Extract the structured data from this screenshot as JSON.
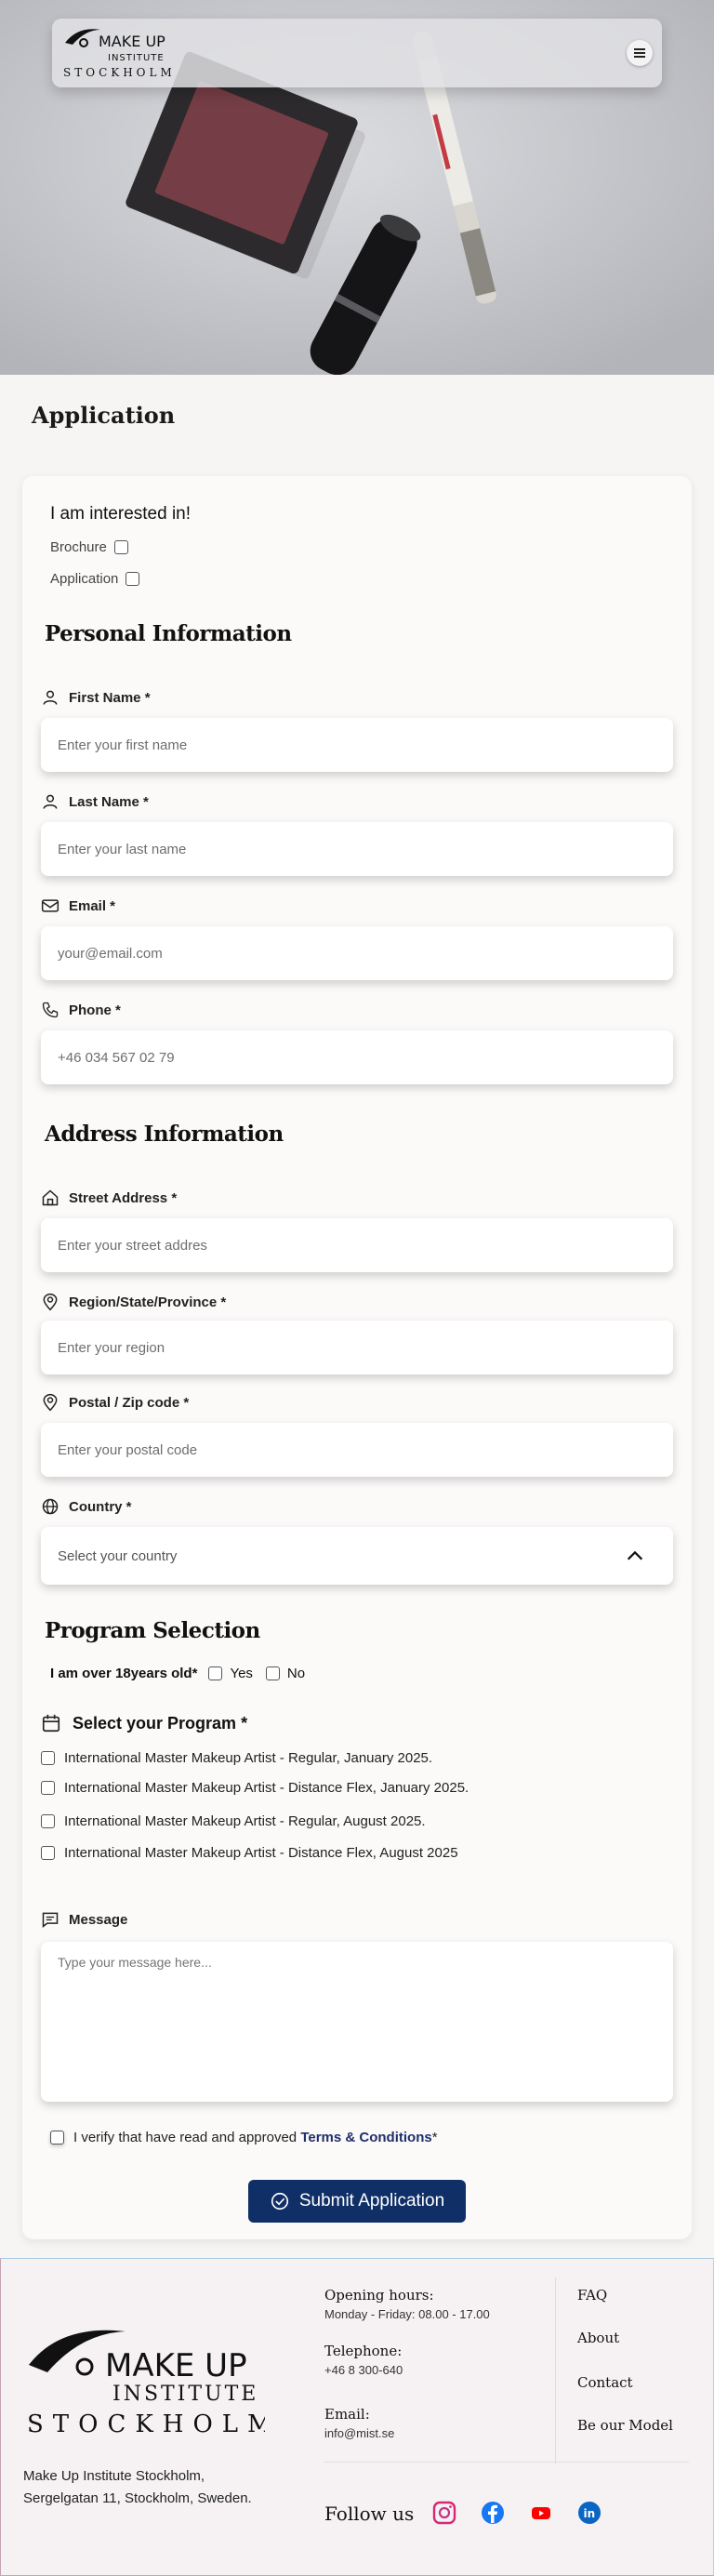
{
  "navbar": {
    "logo_line1": "MAKE UP",
    "logo_line2": "INSTITUTE",
    "logo_line3": "STOCKHOLM",
    "menu_icon": "hamburger-icon"
  },
  "page": {
    "title": "Application"
  },
  "interest": {
    "title": "I am interested in!",
    "options": [
      "Brochure",
      "Application"
    ]
  },
  "personal": {
    "heading": "Personal Information",
    "first_name": {
      "label": "First Name *",
      "placeholder": "Enter your first name"
    },
    "last_name": {
      "label": "Last Name *",
      "placeholder": "Enter your last name"
    },
    "email": {
      "label": "Email *",
      "placeholder": "your@email.com"
    },
    "phone": {
      "label": "Phone *",
      "placeholder": "+46 034 567 02 79"
    }
  },
  "address": {
    "heading": "Address Information",
    "street": {
      "label": "Street Address *",
      "placeholder": "Enter your street addres"
    },
    "region": {
      "label": "Region/State/Province *",
      "placeholder": "Enter your region"
    },
    "postal": {
      "label": "Postal / Zip code *",
      "placeholder": "Enter your postal code"
    },
    "country": {
      "label": "Country *",
      "placeholder": "Select your country"
    }
  },
  "program": {
    "heading": "Program Selection",
    "age_question": "I am over 18years old*",
    "yes": "Yes",
    "no": "No",
    "select_label": "Select your Program *",
    "options": [
      "International Master Makeup Artist - Regular, January 2025.",
      "International Master Makeup Artist - Distance Flex, January 2025.",
      "International Master Makeup Artist - Regular, August 2025.",
      "International Master Makeup Artist - Distance Flex, August 2025"
    ]
  },
  "message": {
    "label": "Message",
    "placeholder": "Type your message here..."
  },
  "verify": {
    "text": "I verify that have read and approved",
    "link": "Terms & Conditions",
    "suffix": "*"
  },
  "submit": {
    "label": "Submit Application"
  },
  "footer": {
    "logo_line1": "MAKE UP",
    "logo_line2": "INSTITUTE",
    "logo_line3": "STOCKHOLM",
    "address_line1": "Make Up Institute Stockholm,",
    "address_line2": "Sergelgatan 11, Stockholm, Sweden.",
    "hours_title": "Opening hours:",
    "hours_value": "Monday - Friday: 08.00  - 17.00",
    "tel_title": "Telephone:",
    "tel_value": "+46 8 300-640",
    "email_title": "Email:",
    "email_value": "info@mist.se",
    "links": [
      "FAQ",
      "About",
      "Contact",
      "Be our Model"
    ],
    "follow": "Follow us",
    "social": [
      "instagram-icon",
      "facebook-icon",
      "youtube-icon",
      "linkedin-icon"
    ],
    "colors": {
      "instagram": "#d62976",
      "facebook": "#1877f2",
      "youtube": "#ff0000",
      "linkedin": "#0a66c2"
    }
  }
}
